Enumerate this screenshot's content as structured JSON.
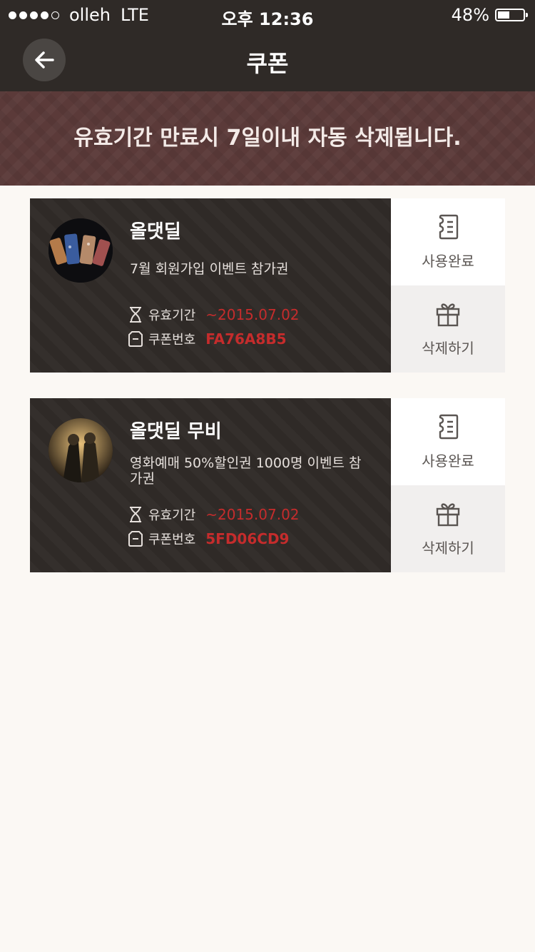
{
  "status_bar": {
    "carrier": "olleh",
    "network": "LTE",
    "time": "오후 12:36",
    "battery": "48%",
    "battery_level": 0.48
  },
  "header": {
    "title": "쿠폰"
  },
  "banner": {
    "text": "유효기간 만료시 7일이내 자동 삭제됩니다."
  },
  "coupons": [
    {
      "title": "올댓딜",
      "desc": "7월 회원가입 이벤트 참가권",
      "expiry_label": "유효기간",
      "expiry_value": "~2015.07.02",
      "code_label": "쿠폰번호",
      "code_value": "FA76A8B5",
      "use_label": "사용완료",
      "delete_label": "삭제하기"
    },
    {
      "title": "올댓딜 무비",
      "desc": "영화예매 50%할인권 1000명 이벤트 참가권",
      "expiry_label": "유효기간",
      "expiry_value": "~2015.07.02",
      "code_label": "쿠폰번호",
      "code_value": "5FD06CD9",
      "use_label": "사용완료",
      "delete_label": "삭제하기"
    }
  ]
}
